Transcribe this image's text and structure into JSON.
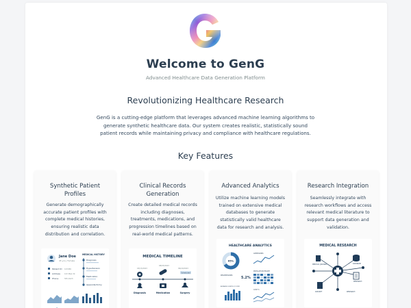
{
  "header": {
    "title": "Welcome to GenG",
    "subtitle": "Advanced Healthcare Data Generation Platform"
  },
  "intro": {
    "heading": "Revolutionizing Healthcare Research",
    "text": "GenG is a cutting-edge platform that leverages advanced machine learning algorithms to generate synthetic healthcare data. Our system creates realistic, statistically sound patient records while maintaining privacy and compliance with healthcare regulations."
  },
  "features": {
    "heading": "Key Features",
    "cards": [
      {
        "title": "Synthetic Patient Profiles",
        "text": "Generate demographically accurate patient profiles with complete medical histories, ensuring realistic data distribution and correlation.",
        "illustration": {
          "name": "Jane Doe",
          "name_sub": "45 yrs | Female",
          "history_label": "MEDICAL HISTORY",
          "fields": [
            "Patient ID",
            "Address",
            "Phone"
          ],
          "field_values": [
            "123456",
            "123 Main St",
            "555-0123"
          ],
          "timeline": [
            "Diagnosis",
            "Hypertension",
            "Medication",
            "Appendectomy"
          ]
        }
      },
      {
        "title": "Clinical Records Generation",
        "text": "Create detailed medical records including diagnoses, treatments, medications, and progression timelines based on real-world medical patterns.",
        "illustration": {
          "heading": "MEDICAL TIMELINE",
          "dates": [
            "03/15/2023",
            "08/05/2023",
            "09/20/2023"
          ],
          "badge": "Scheduled",
          "labels": [
            "Diagnosis",
            "Medication",
            "Surgery"
          ]
        }
      },
      {
        "title": "Advanced Analytics",
        "text": "Utilize machine learning models trained on extensive medical databases to generate statistically valid healthcare data for research and analysis.",
        "illustration": {
          "heading": "HEALTHCARE ANALYTICS",
          "donut_value": "65%",
          "stat_value": "5.2%",
          "labels": [
            "ADMISSIONS",
            "READMISSIONS",
            "POPULATION HEALTH",
            "AVERAGE LENGTH OF STAY",
            "COST S"
          ],
          "accent": "#2f6fa8"
        }
      },
      {
        "title": "Research Integration",
        "text": "Seamlessly integrate with research workflows and access relevant medical literature to support data generation and validation.",
        "illustration": {
          "heading": "MEDICAL RESEARCH",
          "nodes": [
            "MEDICAL JOURNAL",
            "DATABASE",
            "RESEARCH",
            "DATASET",
            "RESEARCH"
          ]
        }
      }
    ]
  }
}
